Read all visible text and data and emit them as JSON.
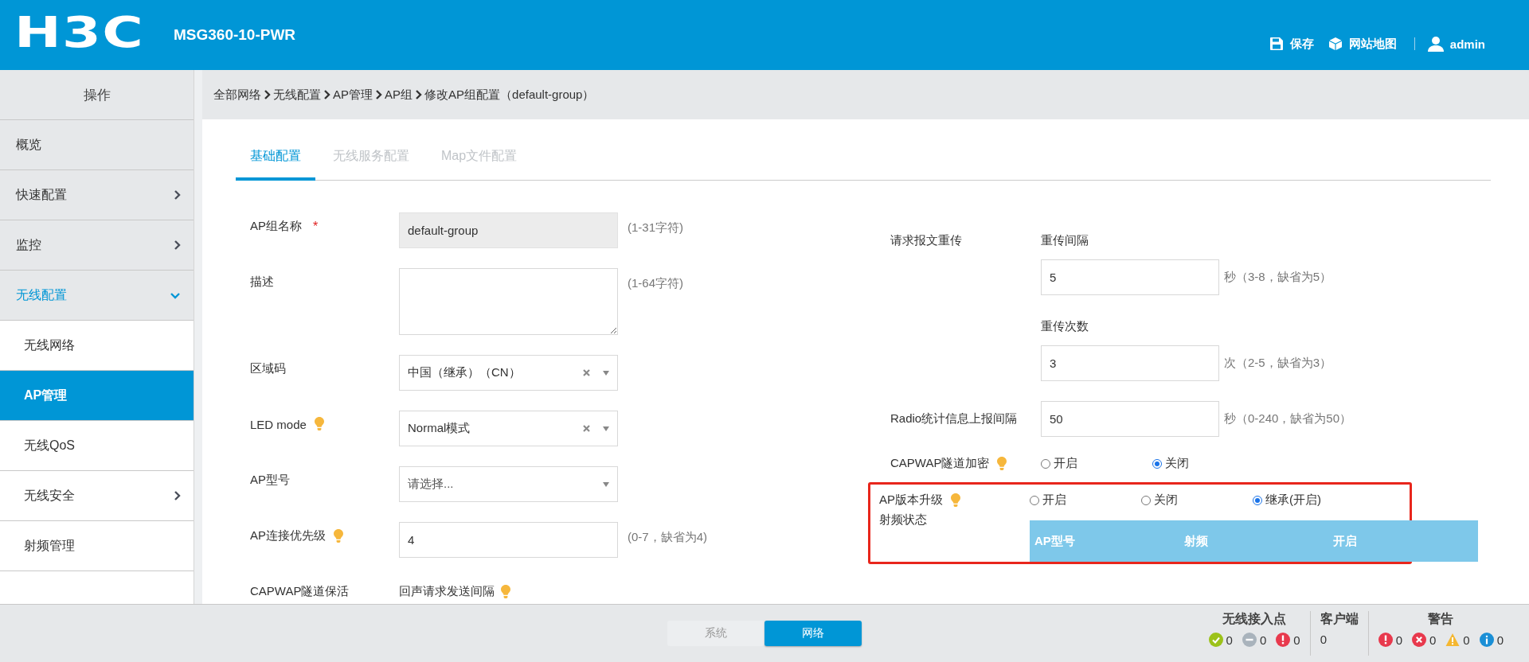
{
  "header": {
    "logo": "H3C",
    "model": "MSG360-10-PWR",
    "actions": [
      {
        "label": "保存"
      },
      {
        "label": "网站地图"
      }
    ],
    "user": "admin"
  },
  "sidebar": {
    "title": "操作",
    "items": [
      {
        "label": "概览",
        "selected": false
      },
      {
        "label": "快速配置",
        "selected": false,
        "expanded": false
      },
      {
        "label": "监控",
        "selected": false,
        "expanded": false
      },
      {
        "label": "无线配置",
        "selected": false,
        "expanded": true,
        "children": [
          {
            "label": "无线网络",
            "selected": false
          },
          {
            "label": "AP管理",
            "selected": true
          },
          {
            "label": "无线QoS",
            "selected": false
          },
          {
            "label": "无线安全",
            "selected": false,
            "expanded": false
          },
          {
            "label": "射频管理",
            "selected": false
          }
        ]
      }
    ]
  },
  "breadcrumb": [
    "全部网络",
    "无线配置",
    "AP管理",
    "AP组",
    "修改AP组配置（default-group）"
  ],
  "tabs": [
    {
      "label": "基础配置",
      "selected": true
    },
    {
      "label": "无线服务配置",
      "selected": false
    },
    {
      "label": "Map文件配置",
      "selected": false
    }
  ],
  "left_form": [
    {
      "kind": "input",
      "label": "AP组名称",
      "required_mark": "*",
      "value": "default-group",
      "readonly": true,
      "hint": "(1-31字符)"
    },
    {
      "kind": "textarea",
      "label": "描述",
      "hint": "(1-64字符)"
    },
    {
      "kind": "select",
      "label": "区域码",
      "value": "中国（继承）（CN）",
      "clearable": true
    },
    {
      "kind": "select",
      "label": "LED mode",
      "tip": true,
      "value": "Normal模式",
      "clearable": true
    },
    {
      "kind": "select",
      "label": "AP型号",
      "placeholder": "请选择...",
      "clearable": false
    },
    {
      "kind": "input",
      "label": "AP连接优先级",
      "tip": true,
      "value": "4",
      "hint": "(0-7，缺省为4)"
    },
    {
      "kind": "subheading",
      "label": "CAPWAP隧道保活",
      "text": "回声请求发送间隔",
      "tip": true
    }
  ],
  "right_form": [
    {
      "kind": "multi-input",
      "label": "请求报文重传",
      "fields": [
        {
          "label": "重传间隔",
          "value": "5",
          "hint": "秒（3-8，缺省为5）"
        },
        {
          "label": "重传次数",
          "value": "3",
          "hint": "次（2-5，缺省为3）"
        }
      ]
    },
    {
      "kind": "input",
      "label": "Radio统计信息上报间隔",
      "value": "50",
      "hint": "秒（0-240，缺省为50）"
    },
    {
      "kind": "radio",
      "label": "CAPWAP隧道加密",
      "tip": true,
      "options": [
        {
          "label": "开启",
          "selected": false
        },
        {
          "label": "关闭",
          "selected": true
        }
      ]
    },
    {
      "kind": "radio",
      "label": "AP版本升级",
      "tip": true,
      "highlighted": true,
      "options": [
        {
          "label": "开启",
          "selected": false
        },
        {
          "label": "关闭",
          "selected": false
        },
        {
          "label": "继承(开启)",
          "selected": true
        }
      ]
    },
    {
      "kind": "table",
      "label": "射频状态",
      "highlighted": true,
      "columns": [
        "AP型号",
        "射频",
        "开启"
      ]
    }
  ],
  "footer": {
    "tabs": [
      {
        "label": "系统",
        "selected": false
      },
      {
        "label": "网络",
        "selected": true
      }
    ],
    "stats": [
      {
        "title": "无线接入点",
        "items": [
          {
            "kind": "ok",
            "count": "0"
          },
          {
            "kind": "offline",
            "count": "0"
          },
          {
            "kind": "error",
            "count": "0"
          }
        ]
      },
      {
        "title": "客户端",
        "value": "0"
      },
      {
        "title": "警告",
        "items": [
          {
            "kind": "error",
            "count": "0"
          },
          {
            "kind": "critical",
            "count": "0"
          },
          {
            "kind": "warning",
            "count": "0"
          },
          {
            "kind": "info",
            "count": "0"
          }
        ]
      }
    ]
  }
}
